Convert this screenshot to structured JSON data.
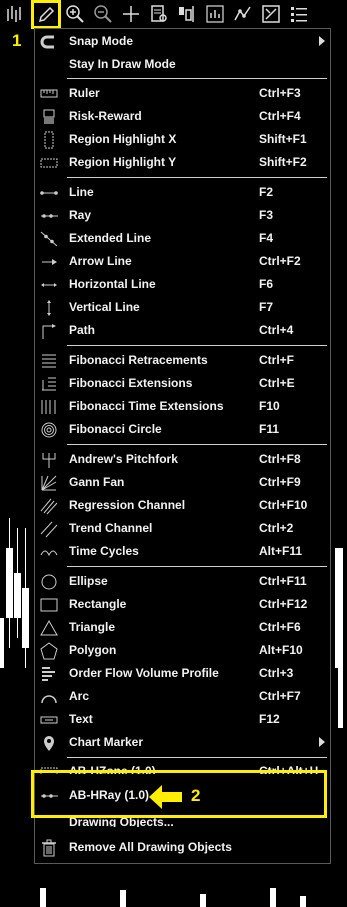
{
  "toolbar": {
    "icons": [
      "bar-chart-icon",
      "pencil-icon",
      "zoom-in-icon",
      "zoom-out-icon",
      "crosshair-icon",
      "data-box-icon",
      "chart-style-icon",
      "indicators-icon",
      "strategy-icon",
      "properties-icon",
      "list-icon"
    ]
  },
  "annotations": {
    "marker1": "1",
    "marker2": "2",
    "accent": "#ffee00"
  },
  "menu": {
    "items": [
      {
        "label": "Snap Mode",
        "shortcut": "",
        "icon": "magnet-icon",
        "submenu": true
      },
      {
        "label": "Stay In Draw Mode",
        "shortcut": "",
        "icon": ""
      },
      {
        "label": "Ruler",
        "shortcut": "Ctrl+F3",
        "icon": "ruler-icon"
      },
      {
        "label": "Risk-Reward",
        "shortcut": "Ctrl+F4",
        "icon": "risk-reward-icon"
      },
      {
        "label": "Region Highlight X",
        "shortcut": "Shift+F1",
        "icon": "region-x-icon"
      },
      {
        "label": "Region Highlight Y",
        "shortcut": "Shift+F2",
        "icon": "region-y-icon"
      },
      {
        "label": "Line",
        "shortcut": "F2",
        "icon": "line-icon"
      },
      {
        "label": "Ray",
        "shortcut": "F3",
        "icon": "ray-icon"
      },
      {
        "label": "Extended Line",
        "shortcut": "F4",
        "icon": "extended-line-icon"
      },
      {
        "label": "Arrow Line",
        "shortcut": "Ctrl+F2",
        "icon": "arrow-line-icon"
      },
      {
        "label": "Horizontal Line",
        "shortcut": "F6",
        "icon": "horizontal-line-icon"
      },
      {
        "label": "Vertical Line",
        "shortcut": "F7",
        "icon": "vertical-line-icon"
      },
      {
        "label": "Path",
        "shortcut": "Ctrl+4",
        "icon": "path-icon"
      },
      {
        "label": "Fibonacci Retracements",
        "shortcut": "Ctrl+F",
        "icon": "fib-retracement-icon"
      },
      {
        "label": "Fibonacci Extensions",
        "shortcut": "Ctrl+E",
        "icon": "fib-extension-icon"
      },
      {
        "label": "Fibonacci Time Extensions",
        "shortcut": "F10",
        "icon": "fib-time-icon"
      },
      {
        "label": "Fibonacci Circle",
        "shortcut": "F11",
        "icon": "fib-circle-icon"
      },
      {
        "label": "Andrew's Pitchfork",
        "shortcut": "Ctrl+F8",
        "icon": "pitchfork-icon"
      },
      {
        "label": "Gann Fan",
        "shortcut": "Ctrl+F9",
        "icon": "gann-fan-icon"
      },
      {
        "label": "Regression Channel",
        "shortcut": "Ctrl+F10",
        "icon": "regression-channel-icon"
      },
      {
        "label": "Trend Channel",
        "shortcut": "Ctrl+2",
        "icon": "trend-channel-icon"
      },
      {
        "label": "Time Cycles",
        "shortcut": "Alt+F11",
        "icon": "time-cycles-icon"
      },
      {
        "label": "Ellipse",
        "shortcut": "Ctrl+F11",
        "icon": "ellipse-icon"
      },
      {
        "label": "Rectangle",
        "shortcut": "Ctrl+F12",
        "icon": "rectangle-icon"
      },
      {
        "label": "Triangle",
        "shortcut": "Ctrl+F6",
        "icon": "triangle-icon"
      },
      {
        "label": "Polygon",
        "shortcut": "Alt+F10",
        "icon": "polygon-icon"
      },
      {
        "label": "Order Flow Volume Profile",
        "shortcut": "Ctrl+3",
        "icon": "volume-profile-icon"
      },
      {
        "label": "Arc",
        "shortcut": "Ctrl+F7",
        "icon": "arc-icon"
      },
      {
        "label": "Text",
        "shortcut": "F12",
        "icon": "text-icon"
      },
      {
        "label": "Chart Marker",
        "shortcut": "",
        "icon": "chart-marker-icon",
        "submenu": true
      },
      {
        "label": "AB-HZone (1.0)",
        "shortcut": "Ctrl+Alt+H",
        "icon": "hzone-icon"
      },
      {
        "label": "AB-HRay (1.0)",
        "shortcut": "",
        "icon": "hray-icon"
      },
      {
        "label": "Drawing Objects...",
        "shortcut": "",
        "icon": ""
      },
      {
        "label": "Remove All Drawing Objects",
        "shortcut": "",
        "icon": "trash-icon"
      }
    ]
  }
}
